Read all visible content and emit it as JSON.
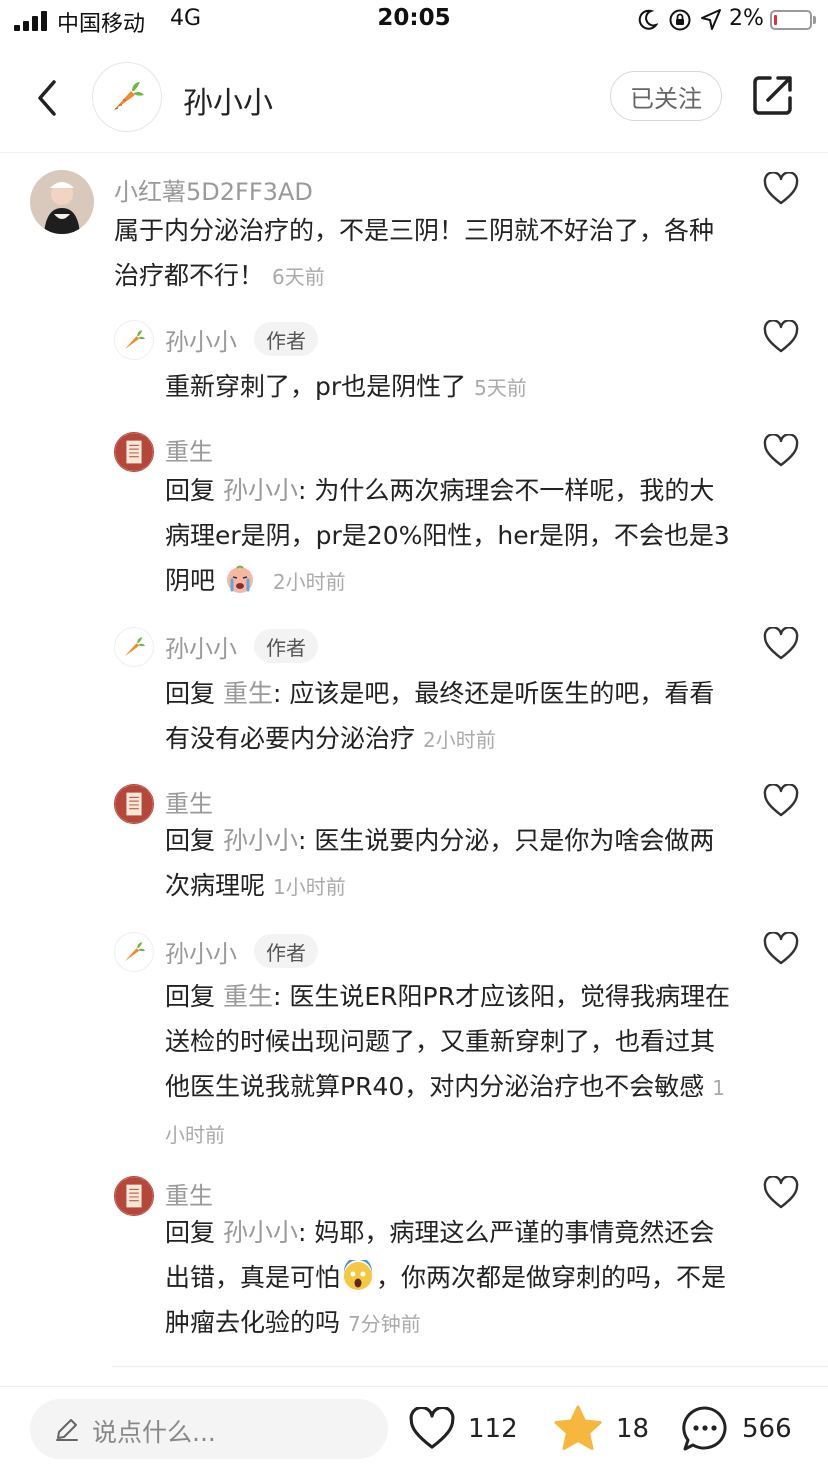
{
  "status": {
    "carrier": "中国移动",
    "network": "4G",
    "time": "20:05",
    "battery": "2%",
    "battery_level": 0.02
  },
  "header": {
    "title": "孙小小",
    "follow_label": "已关注"
  },
  "comments": [
    {
      "name": "小红薯5D2FF3AD",
      "text": "属于内分泌治疗的，不是三阴！三阴就不好治了，各种治疗都不行！",
      "time": "6天前"
    },
    {
      "name": "孙小小",
      "tag": "作者",
      "text": "重新穿刺了，pr也是阴性了",
      "time": "5天前"
    },
    {
      "name": "重生",
      "reply_word": "回复",
      "reply_to": "孙小小",
      "text": ": 为什么两次病理会不一样呢，我的大病理er是阴，pr是20%阳性，her是阴，不会也是3阴吧",
      "emoji": "crying-face",
      "time": "2小时前"
    },
    {
      "name": "孙小小",
      "tag": "作者",
      "reply_word": "回复",
      "reply_to": "重生",
      "text": ": 应该是吧，最终还是听医生的吧，看看有没有必要内分泌治疗",
      "time": "2小时前"
    },
    {
      "name": "重生",
      "reply_word": "回复",
      "reply_to": "孙小小",
      "text": ": 医生说要内分泌，只是你为啥会做两次病理呢",
      "time": "1小时前"
    },
    {
      "name": "孙小小",
      "tag": "作者",
      "reply_word": "回复",
      "reply_to": "重生",
      "text": ": 医生说ER阳PR才应该阳，觉得我病理在送检的时候出现问题了，又重新穿刺了，也看过其他医生说我就算PR40，对内分泌治疗也不会敏感",
      "time": "1小时前"
    },
    {
      "name": "重生",
      "reply_word": "回复",
      "reply_to": "孙小小",
      "text_a": ": 妈耶，病理这么严谨的事情竟然还会出错，真是可怕",
      "emoji": "screaming-face",
      "text_b": "，你两次都是做穿刺的吗，不是肿瘤去化验的吗",
      "time": "7分钟前"
    }
  ],
  "bottom": {
    "placeholder": "说点什么...",
    "likes": "112",
    "collects": "18",
    "comments": "566"
  },
  "colors": {
    "collect_star": "#f6b73c",
    "secondary_text": "#999999"
  }
}
